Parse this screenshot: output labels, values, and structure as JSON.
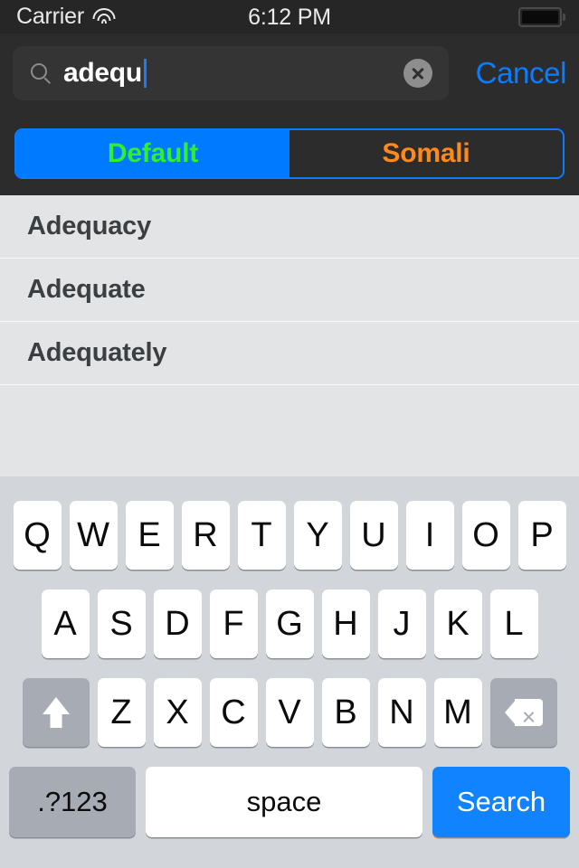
{
  "status_bar": {
    "carrier": "Carrier",
    "wifi_icon": "wifi-icon",
    "time": "6:12 PM",
    "battery_icon": "battery-full-icon"
  },
  "search": {
    "icon": "search-icon",
    "value": "adequ",
    "placeholder": "Search",
    "clear_icon": "clear-circle-icon",
    "cancel_label": "Cancel",
    "accent_color": "#0a7cff",
    "caret_color": "#1a7df5"
  },
  "segmented_control": {
    "selected_index": 0,
    "border_color": "#0a7cff",
    "segments": [
      {
        "label": "Default",
        "active": true,
        "text_color": "#2ef02e",
        "bg_color": "#007aff"
      },
      {
        "label": "Somali",
        "active": false,
        "text_color": "#ff8a1a",
        "bg_color": "#2c2c2c"
      }
    ]
  },
  "results": {
    "items": [
      {
        "word": "Adequacy"
      },
      {
        "word": "Adequate"
      },
      {
        "word": "Adequately"
      }
    ],
    "row_bg": "#e3e4e6",
    "text_color": "#3c3f42"
  },
  "keyboard": {
    "background": "#d2d5da",
    "row1": [
      "Q",
      "W",
      "E",
      "R",
      "T",
      "Y",
      "U",
      "I",
      "O",
      "P"
    ],
    "row2": [
      "A",
      "S",
      "D",
      "F",
      "G",
      "H",
      "J",
      "K",
      "L"
    ],
    "row3": [
      "Z",
      "X",
      "C",
      "V",
      "B",
      "N",
      "M"
    ],
    "shift_icon": "shift-arrow-up-icon",
    "backspace_icon": "backspace-delete-icon",
    "numbers_label": ".?123",
    "space_label": "space",
    "search_label": "Search",
    "search_key_color": "#1283ff"
  }
}
